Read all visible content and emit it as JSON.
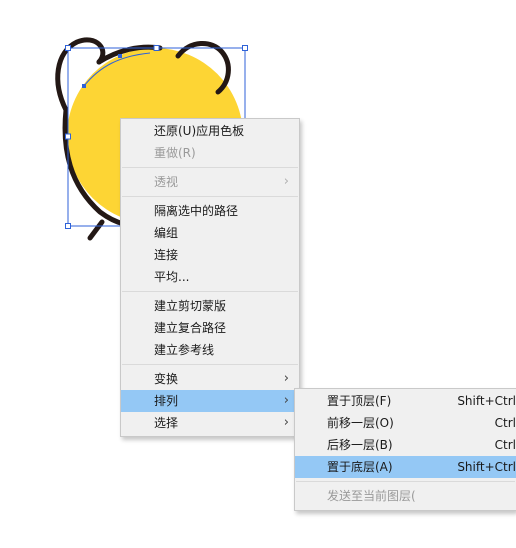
{
  "colors": {
    "fill": "#fdd534",
    "outline": "#231815",
    "selection": "#2f62d8",
    "menu_bg": "#f0f0f0",
    "highlight": "#94c8f5"
  },
  "artwork": {
    "shape_icon": "bear-head-icon"
  },
  "context_menu": {
    "items": [
      {
        "label": "还原(U)应用色板",
        "disabled": false
      },
      {
        "label": "重做(R)",
        "disabled": true
      },
      {
        "label": "透视",
        "disabled": true,
        "submenu": true
      },
      {
        "label": "隔离选中的路径",
        "disabled": false
      },
      {
        "label": "编组",
        "disabled": false
      },
      {
        "label": "连接",
        "disabled": false
      },
      {
        "label": "平均...",
        "disabled": false
      },
      {
        "label": "建立剪切蒙版",
        "disabled": false
      },
      {
        "label": "建立复合路径",
        "disabled": false
      },
      {
        "label": "建立参考线",
        "disabled": false
      },
      {
        "label": "变换",
        "disabled": false,
        "submenu": true
      },
      {
        "label": "排列",
        "disabled": false,
        "submenu": true,
        "selected": true
      },
      {
        "label": "选择",
        "disabled": false,
        "submenu": true
      }
    ],
    "arrow_glyph": "›"
  },
  "arrange_submenu": {
    "items": [
      {
        "label": "置于顶层(F)",
        "shortcut": "Shift+Ctrl"
      },
      {
        "label": "前移一层(O)",
        "shortcut": "Ctrl"
      },
      {
        "label": "后移一层(B)",
        "shortcut": "Ctrl"
      },
      {
        "label": "置于底层(A)",
        "shortcut": "Shift+Ctrl",
        "selected": true
      },
      {
        "label": "发送至当前图层(",
        "disabled": true
      }
    ]
  }
}
